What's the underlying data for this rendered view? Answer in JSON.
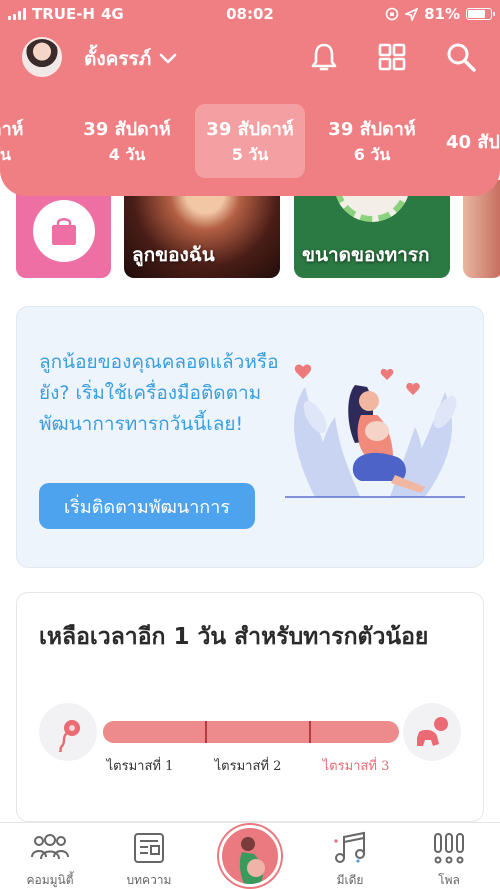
{
  "status_bar": {
    "carrier": "TRUE-H",
    "network": "4G",
    "time": "08:02",
    "battery_text": "81%",
    "battery_level": 0.81
  },
  "header": {
    "profile_name": "ตั้งครรภ์",
    "icons": [
      "bell-icon",
      "grid-icon",
      "search-icon"
    ],
    "background_color": "#f07f83"
  },
  "weeks": [
    {
      "week": "ปดาห์",
      "days": "วัน"
    },
    {
      "week": "39 สัปดาห์",
      "days": "4 วัน"
    },
    {
      "week": "39 สัปดาห์",
      "days": "5 วัน"
    },
    {
      "week": "39 สัปดาห์",
      "days": "6 วัน"
    },
    {
      "week": "40 สัป",
      "days": ""
    }
  ],
  "tiles": [
    {
      "label": "",
      "icon": "shopping-bag-icon"
    },
    {
      "label": "ลูกของฉัน"
    },
    {
      "label": "ขนาดของทารก"
    }
  ],
  "tracker": {
    "text": "ลูกน้อยของคุณคลอดแล้วหรือยัง? เริ่มใช้เครื่องมือติดตามพัฒนาการทารกวันนี้เลย!",
    "button_label": "เริ่มติดตามพัฒนาการ",
    "text_color": "#3a9fe0",
    "button_color": "#4da3ee"
  },
  "countdown": {
    "title": "เหลือเวลาอีก 1 วัน สำหรับทารกตัวน้อย",
    "trimesters": [
      "ไตรมาสที่ 1",
      "ไตรมาสที่ 2",
      "ไตรมาสที่ 3"
    ],
    "current_trimester": 3,
    "progress": 0.99,
    "icons": [
      "sperm-icon",
      "crawling-baby-icon"
    ]
  },
  "bottom_nav": {
    "items": [
      {
        "label": "คอมมูนิตี้",
        "icon": "community-icon"
      },
      {
        "label": "บทความ",
        "icon": "article-icon"
      },
      {
        "label": "",
        "icon": "pregnancy-icon"
      },
      {
        "label": "มีเดีย",
        "icon": "music-note-icon"
      },
      {
        "label": "โพล",
        "icon": "poll-icon"
      }
    ]
  }
}
